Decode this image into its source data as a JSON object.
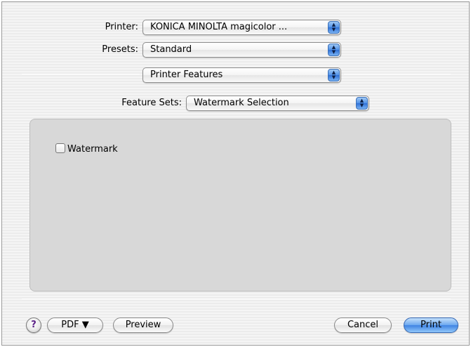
{
  "printer": {
    "label": "Printer:",
    "value": "KONICA MINOLTA magicolor ..."
  },
  "presets": {
    "label": "Presets:",
    "value": "Standard"
  },
  "panel_selector": {
    "value": "Printer Features"
  },
  "feature_sets": {
    "label": "Feature Sets:",
    "value": "Watermark Selection"
  },
  "options": {
    "watermark": {
      "label": "Watermark",
      "checked": false
    }
  },
  "footer": {
    "help_label": "?",
    "pdf_label": "PDF ▼",
    "preview_label": "Preview",
    "cancel_label": "Cancel",
    "print_label": "Print"
  },
  "icons": {
    "popup_arrows": "up-down-arrows-icon",
    "help": "help-icon",
    "checkbox": "checkbox-icon"
  },
  "colors": {
    "accent": "#4f90e8",
    "panel_bg": "#d8d8d8"
  }
}
